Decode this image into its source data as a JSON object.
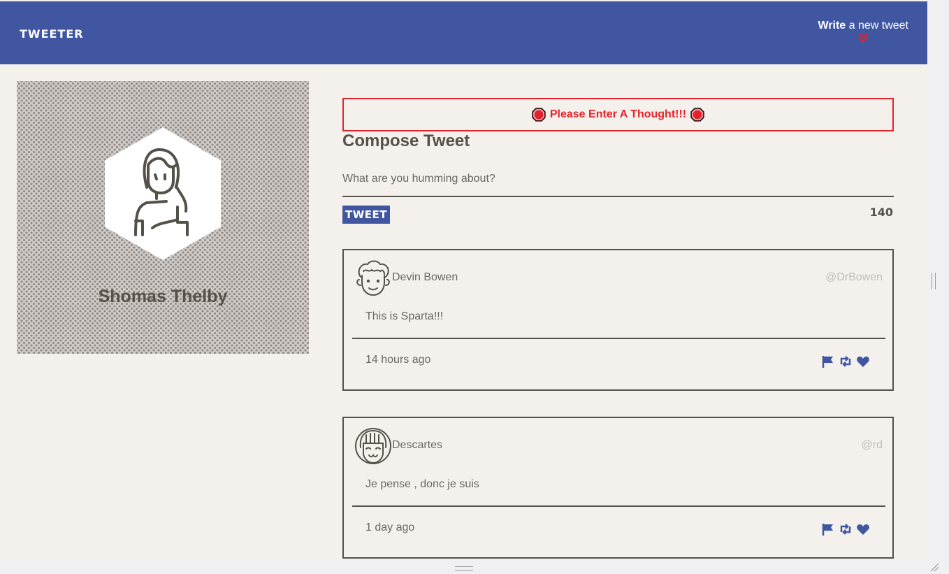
{
  "nav": {
    "brand": "TWEETER",
    "write_bold": "Write",
    "write_rest": " a new tweet",
    "accent_color": "#e4222b",
    "bg_color": "#4056a1"
  },
  "profile": {
    "name": "Shomas Thelby",
    "avatar_icon": "woman-avatar-icon"
  },
  "error": {
    "message": "Please Enter A Thought!!!",
    "icon": "stop-sign-icon"
  },
  "compose": {
    "title": "Compose Tweet",
    "placeholder": "What are you humming about?",
    "submit_label": "TWEET",
    "counter": "140"
  },
  "tweets": [
    {
      "name": "Devin Bowen",
      "handle": "@DrBowen",
      "text": "This is Sparta!!!",
      "time": "14 hours ago",
      "avatar_icon": "curly-hair-man-avatar-icon"
    },
    {
      "name": "Descartes",
      "handle": "@rd",
      "text": "Je pense , donc je suis",
      "time": "1 day ago",
      "avatar_icon": "bangs-girl-avatar-icon"
    }
  ],
  "actions": [
    "flag-icon",
    "retweet-icon",
    "heart-icon"
  ]
}
